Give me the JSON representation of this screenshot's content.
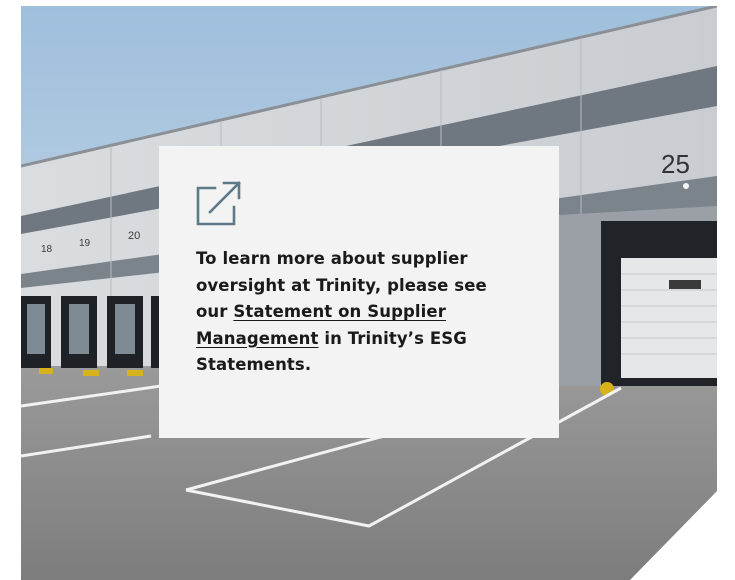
{
  "card": {
    "icon": "external-link-icon",
    "text_before": "To learn more about supplier oversight at Trinity, please see our ",
    "link_text": "Statement on Supplier Management",
    "text_after": " in Trinity’s ESG Statements."
  },
  "photo": {
    "dock_numbers": [
      "18",
      "19",
      "20"
    ],
    "bay_number": "25"
  },
  "colors": {
    "card_bg": "#f3f3f3",
    "text": "#1a1a1a",
    "icon_stroke": "#5e7a88",
    "wall_stripe": "#6f7880",
    "sky": "#b9cfe2"
  }
}
